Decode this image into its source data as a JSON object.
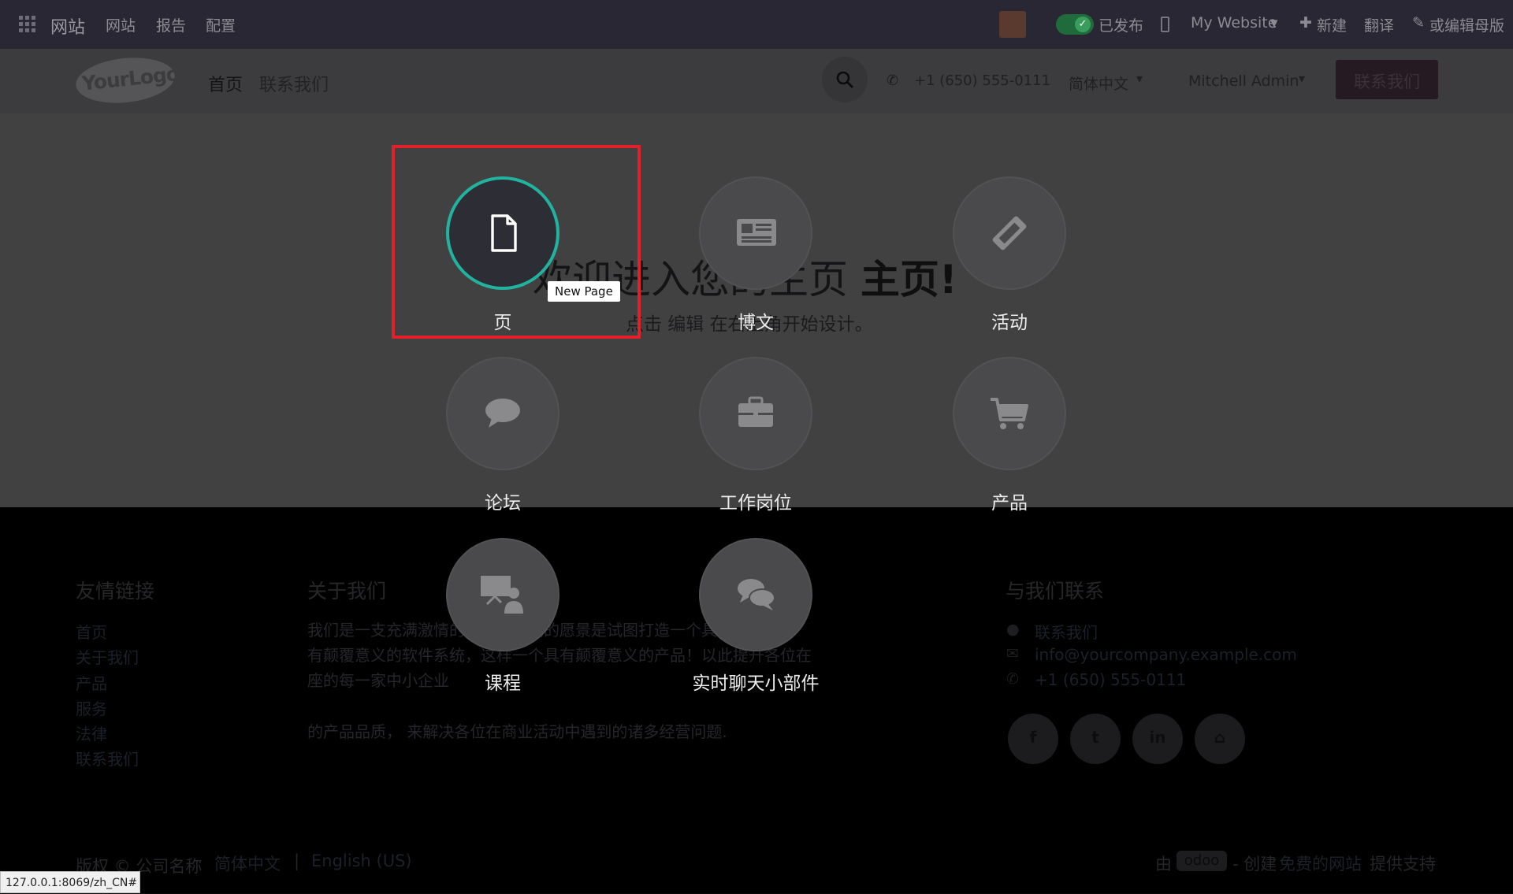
{
  "topbar": {
    "app_name": "网站",
    "menu": [
      "网站",
      "报告",
      "配置"
    ],
    "published_label": "已发布",
    "website_selector": "My Website",
    "new_label": "新建",
    "translate_label": "翻译",
    "edit_label": "或编辑母版"
  },
  "header": {
    "logo_text": "YourLogo",
    "nav": [
      "首页",
      "联系我们"
    ],
    "phone": "+1 (650) 555-0111",
    "language": "简体中文",
    "user": "Mitchell Admin",
    "contact_button": "联系我们"
  },
  "hero": {
    "title_prefix": "欢迎进入您的主页",
    "title_bold": "主页!",
    "subtitle": "点击 编辑 在右上角开始设计。"
  },
  "apps": [
    {
      "label": "页",
      "icon": "page-icon",
      "active": true
    },
    {
      "label": "博文",
      "icon": "newspaper-icon"
    },
    {
      "label": "活动",
      "icon": "ticket-icon"
    },
    {
      "label": "论坛",
      "icon": "comment-icon"
    },
    {
      "label": "工作岗位",
      "icon": "briefcase-icon"
    },
    {
      "label": "产品",
      "icon": "cart-icon"
    },
    {
      "label": "课程",
      "icon": "presentation-icon"
    },
    {
      "label": "实时聊天小部件",
      "icon": "chat-icon"
    }
  ],
  "tooltip": "New Page",
  "footer": {
    "links_title": "友情链接",
    "links": [
      "首页",
      "关于我们",
      "产品",
      "服务",
      "法律",
      "联系我们"
    ],
    "about_title": "关于我们",
    "about_lines": [
      "我们是一支充满激情的团队！我们的愿景是试图打造一个具",
      "有颠覆意义的软件系统，这样一个具有颠覆意义的产品！以此提升各位在",
      "座的每一家中小企业",
      "",
      "的产品品质， 来解决各位在商业活动中遇到的诸多经营问题."
    ],
    "contact_title": "与我们联系",
    "contact_items": [
      "联系我们",
      "info@yourcompany.example.com",
      "+1 (650) 555-0111"
    ],
    "social": [
      "f",
      "t",
      "in",
      "home"
    ],
    "copyright": "版权 © 公司名称",
    "lang_zh": "简体中文",
    "lang_sep": "|",
    "lang_en": "English (US)",
    "powered_prefix": "由",
    "powered_brand": "odoo",
    "powered_mid": "- 创建",
    "powered_link": "免费的网站",
    "powered_suffix": "提供支持"
  },
  "status_url": "127.0.0.1:8069/zh_CN#"
}
